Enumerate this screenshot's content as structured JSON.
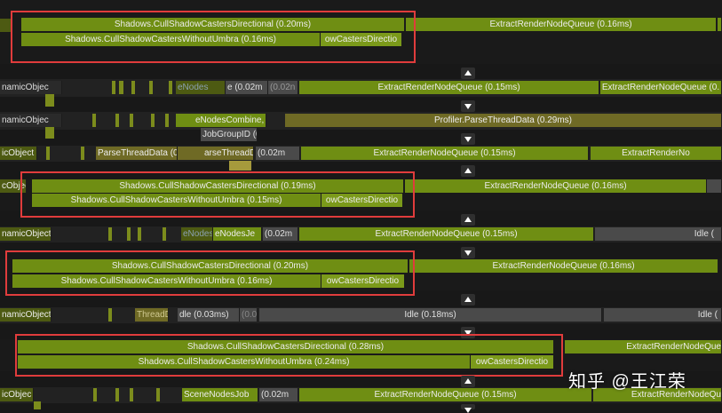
{
  "profiler_bars": [
    {
      "label": "Shadows.CullShadowCastersDirectional (0.20ms)"
    },
    {
      "label": "ExtractRenderNodeQueue (0.16ms)"
    },
    {
      "label": "Shadows.CullShadowCastersWithoutUmbra (0.16ms)"
    },
    {
      "label": "owCastersDirectio"
    },
    {
      "label": "namicObjec"
    },
    {
      "label": "eNodes"
    },
    {
      "label": "e (0.02m"
    },
    {
      "label": "(0.02n"
    },
    {
      "label": "ExtractRenderNodeQueue (0.15ms)"
    },
    {
      "label": "ExtractRenderNodeQueue (0."
    },
    {
      "label": "namicObjec"
    },
    {
      "label": "eNodesCombine,"
    },
    {
      "label": "Profiler.ParseThreadData (0.29ms)"
    },
    {
      "label": "JobGroupID (0"
    },
    {
      "label": "icObject"
    },
    {
      "label": "ParseThreadData (0"
    },
    {
      "label": "arseThreadData"
    },
    {
      "label": "(0.02m"
    },
    {
      "label": "ExtractRenderNodeQueue (0.15ms)"
    },
    {
      "label": "ExtractRenderNo"
    },
    {
      "label": "cObjec"
    },
    {
      "label": "Shadows.CullShadowCastersDirectional (0.19ms)"
    },
    {
      "label": "ExtractRenderNodeQueue (0.16ms)"
    },
    {
      "label": "Shadows.CullShadowCastersWithoutUmbra (0.15ms)"
    },
    {
      "label": "owCastersDirectio"
    },
    {
      "label": "namicObject"
    },
    {
      "label": "eNodes"
    },
    {
      "label": "eNodesJe"
    },
    {
      "label": "(0.02m"
    },
    {
      "label": "ExtractRenderNodeQueue (0.15ms)"
    },
    {
      "label": "Idle ("
    },
    {
      "label": "Shadows.CullShadowCastersDirectional (0.20ms)"
    },
    {
      "label": "ExtractRenderNodeQueue (0.16ms)"
    },
    {
      "label": "Shadows.CullShadowCastersWithoutUmbra (0.16ms)"
    },
    {
      "label": "owCastersDirectio"
    },
    {
      "label": "namicObject"
    },
    {
      "label": "ThreadD"
    },
    {
      "label": "dle (0.03ms)"
    },
    {
      "label": "(0.01"
    },
    {
      "label": "Idle (0.18ms)"
    },
    {
      "label": "Idle ("
    },
    {
      "label": "Shadows.CullShadowCastersDirectional (0.28ms)"
    },
    {
      "label": "ExtractRenderNodeQue"
    },
    {
      "label": "Shadows.CullShadowCastersWithoutUmbra (0.24ms)"
    },
    {
      "label": "owCastersDirectio"
    },
    {
      "label": "icObjec"
    },
    {
      "label": "SceneNodesJob"
    },
    {
      "label": "(0.02m"
    },
    {
      "label": "ExtractRenderNodeQueue (0.15ms)"
    },
    {
      "label": "ExtractRenderNodeQu"
    }
  ],
  "watermark": "知乎 @王江荣",
  "colors": {
    "bar_green": "#6f8e13",
    "highlight": "#e03c3c",
    "idle": "#4a4a4a",
    "background": "#181818"
  }
}
